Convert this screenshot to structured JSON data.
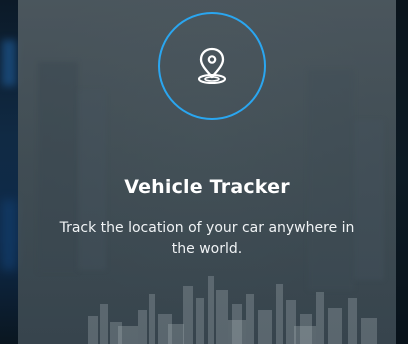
{
  "feature": {
    "icon": "location-pin-icon",
    "title": "Vehicle Tracker",
    "description": "Track the location of your car anywhere in the world."
  },
  "colors": {
    "accent": "#2aa6f0",
    "text": "#ffffff"
  }
}
